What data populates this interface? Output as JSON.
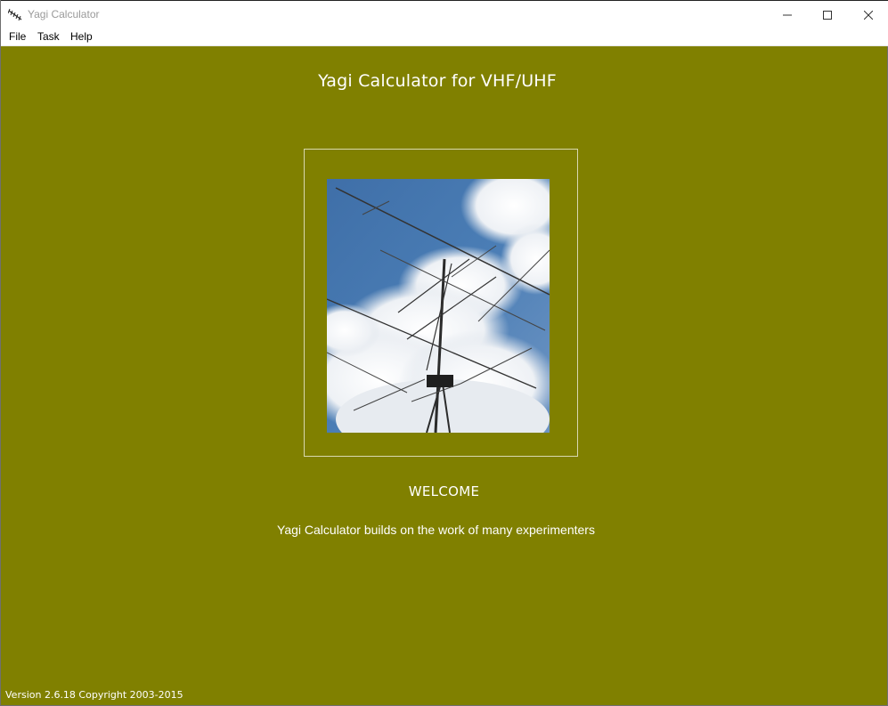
{
  "window": {
    "title": "Yagi Calculator",
    "icon": "antenna-icon",
    "controls": [
      "minimize-icon",
      "maximize-icon",
      "close-icon"
    ]
  },
  "menu": {
    "file": "File",
    "task": "Task",
    "help": "Help"
  },
  "main": {
    "heading": "Yagi Calculator  for VHF/UHF",
    "welcome": "WELCOME",
    "credits": "Yagi Calculator  builds on the work of many experimenters",
    "version": "Version 2.6.18  Copyright 2003-2015",
    "photo": "yagi-antenna-photo"
  },
  "colors": {
    "background": "#808000",
    "text": "#ffffff",
    "titlebar": "#ffffff"
  }
}
